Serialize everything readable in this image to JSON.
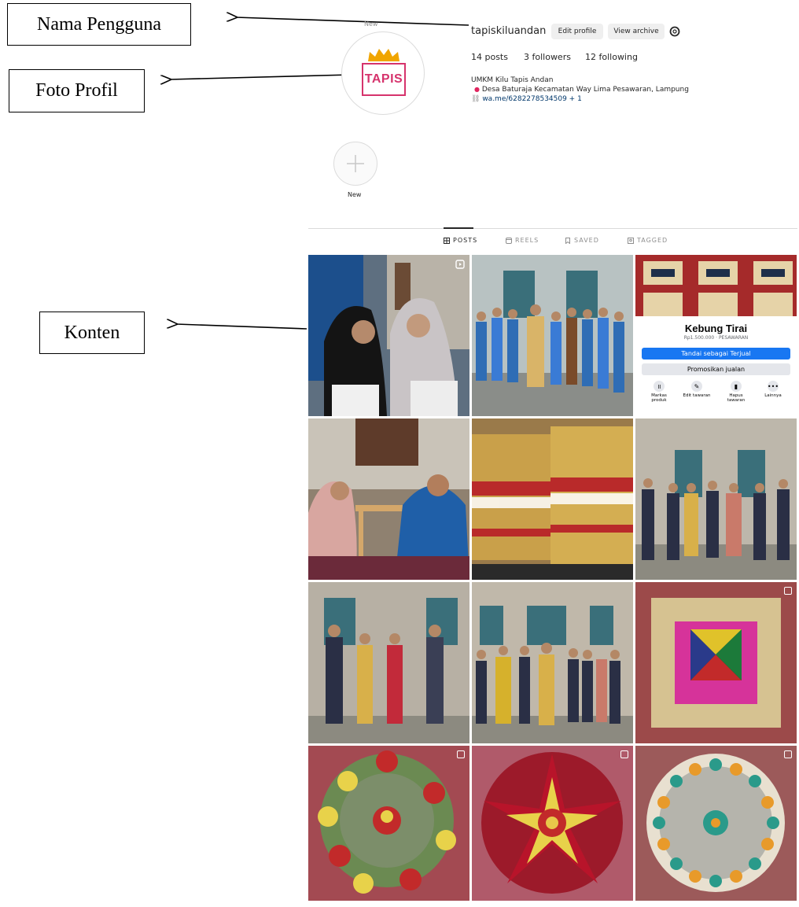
{
  "annotations": {
    "username_label": "Nama Pengguna",
    "photo_label": "Foto Profil",
    "content_label": "Konten"
  },
  "profile": {
    "username": "tapiskiluandan",
    "edit_profile": "Edit profile",
    "view_archive": "View archive",
    "avatar_new_caption": "New",
    "logo_text": "TAPIS",
    "posts": "14 posts",
    "followers": "3 followers",
    "following": "12 following",
    "bio_name": "UMKM Kilu Tapis Andan",
    "bio_location": "Desa Baturaja Kecamatan Way Lima Pesawaran, Lampung",
    "bio_link": "wa.me/6282278534509 + 1"
  },
  "highlight": {
    "new_caption": "New"
  },
  "tabs": [
    {
      "label": "POSTS",
      "icon": "grid-icon",
      "active": true
    },
    {
      "label": "REELS",
      "icon": "reels-icon",
      "active": false
    },
    {
      "label": "SAVED",
      "icon": "bookmark-icon",
      "active": false
    },
    {
      "label": "TAGGED",
      "icon": "tag-icon",
      "active": false
    }
  ],
  "marketplace": {
    "title": "Kebung Tirai",
    "price": "Rp1.500.000 · PESAWARAN",
    "mark_sold": "Tandai sebagai Terjual",
    "promote": "Promosikan jualan",
    "actions": [
      {
        "label": "Markas produk",
        "icon": "pause-icon"
      },
      {
        "label": "Edit tawaran",
        "icon": "pencil-icon"
      },
      {
        "label": "Hapus tawaran",
        "icon": "trash-icon"
      },
      {
        "label": "Lainnya",
        "icon": "more-icon"
      }
    ]
  },
  "colors": {
    "primary_blue": "#1877f2",
    "link": "#00376b",
    "logo_pink": "#d6336c"
  }
}
